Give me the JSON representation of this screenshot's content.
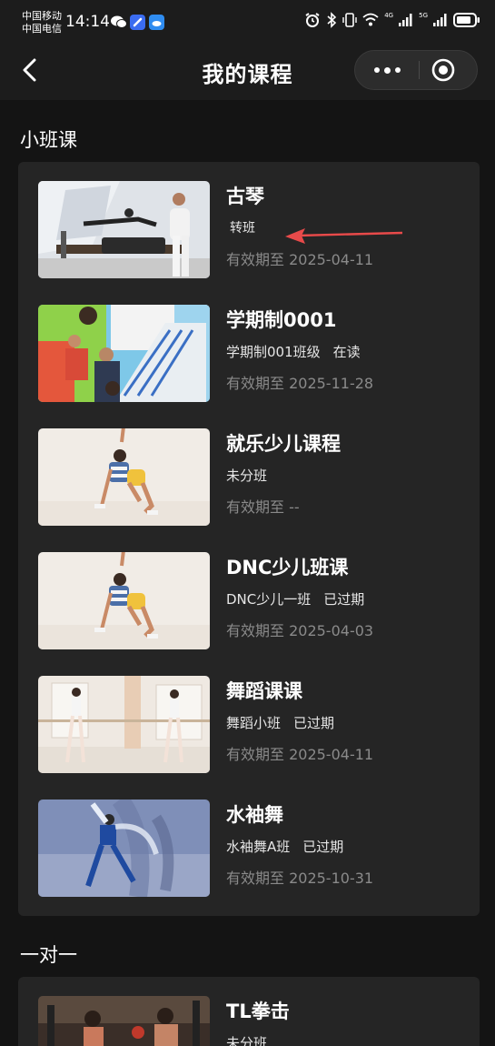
{
  "status_bar": {
    "carrier_1": "中国移动",
    "carrier_2": "中国电信",
    "time": "14:14",
    "net_1": "4G",
    "net_2": "5G"
  },
  "nav": {
    "title": "我的课程",
    "icons": [
      "back-icon",
      "more-icon",
      "close-target-icon"
    ]
  },
  "sections": {
    "small_class": {
      "title": "小班课",
      "courses": [
        {
          "name": "古琴",
          "class_name": "转班",
          "status": "",
          "expiry": "有效期至 2025-04-11",
          "thumb": "pilates"
        },
        {
          "name": "学期制0001",
          "class_name": "学期制001班级",
          "status": "在读",
          "expiry": "有效期至 2025-11-28",
          "thumb": "playground"
        },
        {
          "name": "就乐少儿课程",
          "class_name": "未分班",
          "status": "",
          "expiry": "有效期至 --",
          "thumb": "dance-boy"
        },
        {
          "name": "DNC少儿班课",
          "class_name": "DNC少儿一班",
          "status": "已过期",
          "expiry": "有效期至 2025-04-03",
          "thumb": "dance-boy"
        },
        {
          "name": "舞蹈课课",
          "class_name": "舞蹈小班",
          "status": "已过期",
          "expiry": "有效期至 2025-04-11",
          "thumb": "ballet"
        },
        {
          "name": "水袖舞",
          "class_name": "水袖舞A班",
          "status": "已过期",
          "expiry": "有效期至 2025-10-31",
          "thumb": "sleeve-dance"
        }
      ]
    },
    "one_on_one": {
      "title": "一对一",
      "courses": [
        {
          "name": "TL拳击",
          "class_name": "未分班",
          "status": "",
          "expiry": "",
          "thumb": "boxing"
        }
      ]
    }
  },
  "colors": {
    "background": "#141414",
    "card": "#252525",
    "nav": "#1c1c1c",
    "arrow": "#e84a4a",
    "expiry_text": "#8a8a8a"
  }
}
